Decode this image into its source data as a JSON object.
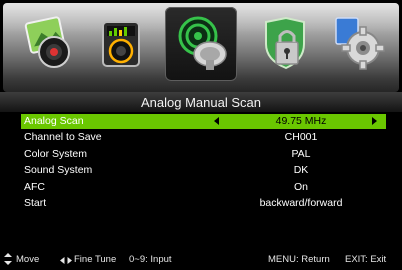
{
  "menu_icons": [
    {
      "name": "picture-icon"
    },
    {
      "name": "sound-icon"
    },
    {
      "name": "channel-icon",
      "selected": true
    },
    {
      "name": "lock-icon"
    },
    {
      "name": "setup-icon"
    }
  ],
  "title": "Analog Manual Scan",
  "rows": [
    {
      "label": "Analog Scan",
      "value": "49.75 MHz",
      "active": true
    },
    {
      "label": "Channel to Save",
      "value": "CH001"
    },
    {
      "label": "Color System",
      "value": "PAL"
    },
    {
      "label": "Sound System",
      "value": "DK"
    },
    {
      "label": "AFC",
      "value": "On"
    },
    {
      "label": "Start",
      "value": "backward/forward"
    }
  ],
  "help": {
    "move": "Move",
    "fine_tune": "Fine Tune",
    "input": "0~9: Input",
    "menu": "MENU: Return",
    "exit": "EXIT: Exit"
  },
  "colors": {
    "highlight": "#6ac700",
    "background": "#000000"
  }
}
